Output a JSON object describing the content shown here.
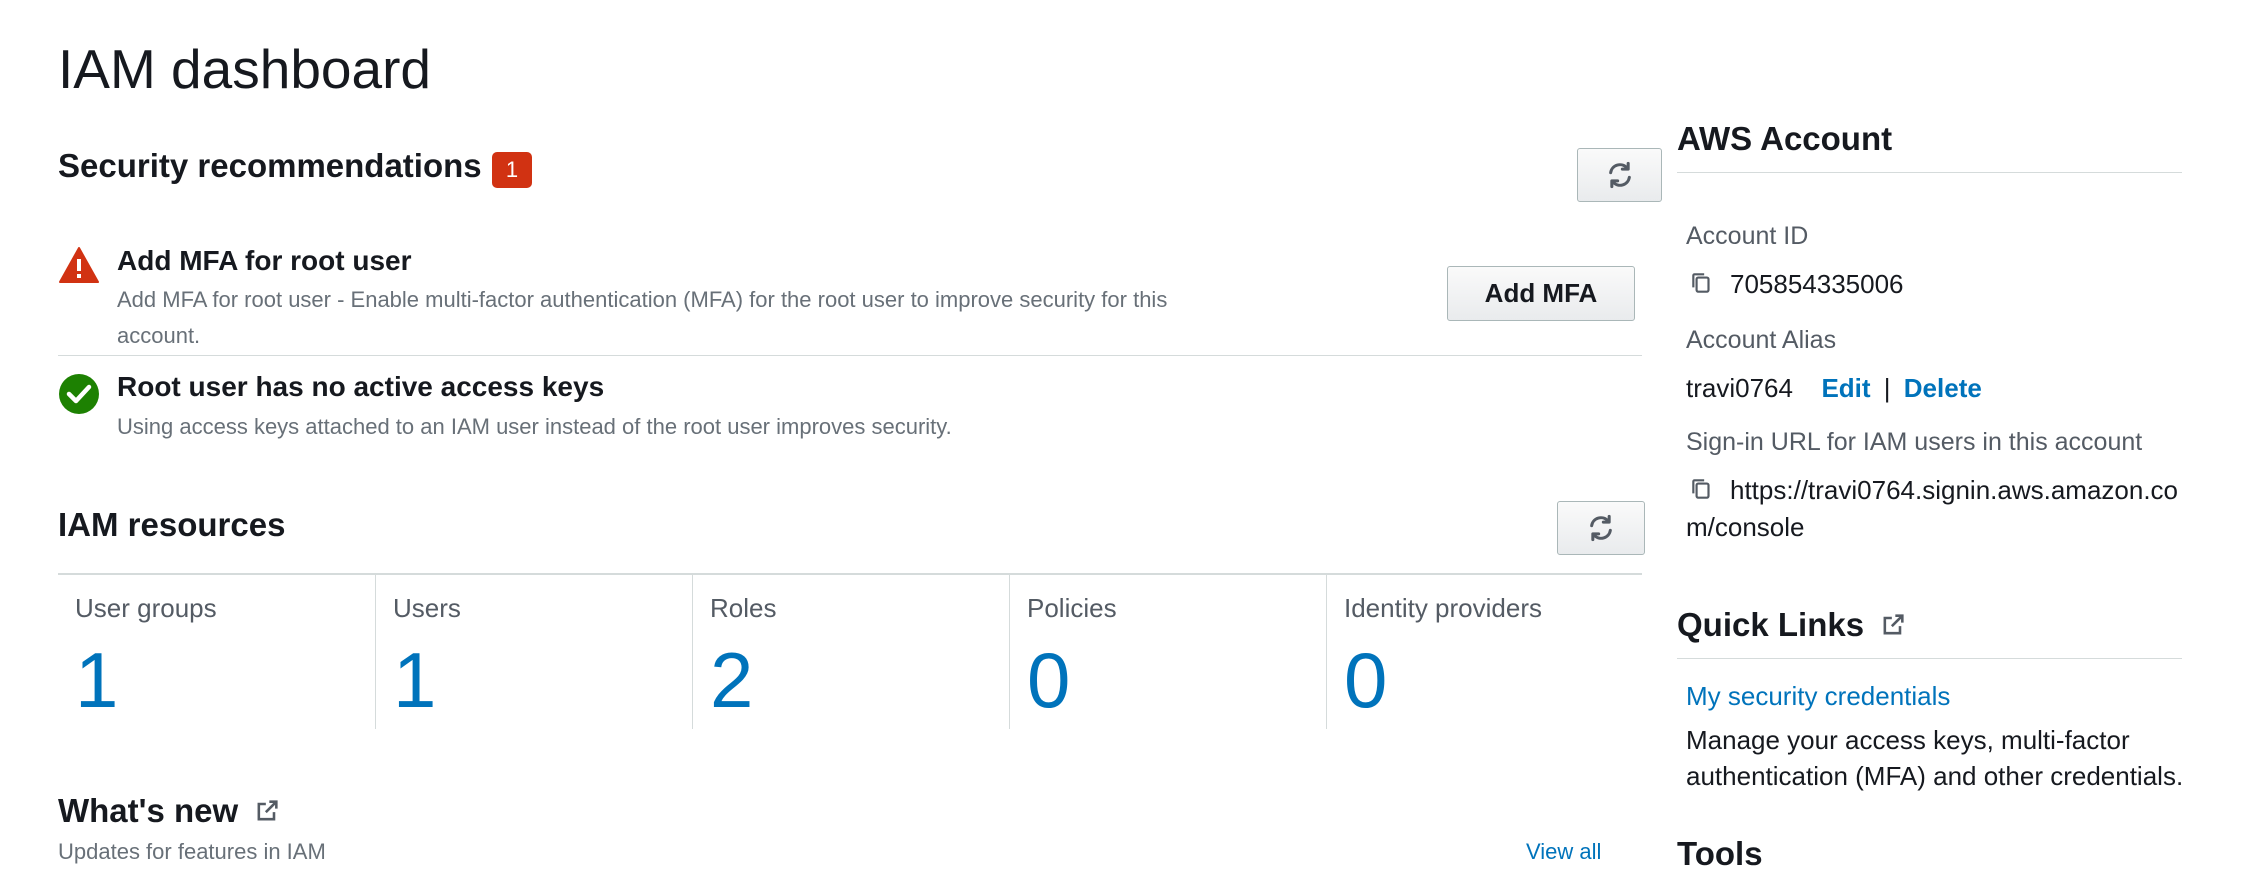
{
  "page": {
    "title": "IAM dashboard"
  },
  "security": {
    "heading": "Security recommendations",
    "badge_count": "1",
    "items": [
      {
        "title": "Add MFA for root user",
        "description_line1": "Add MFA for root user - Enable multi-factor authentication (MFA) for the root user to improve security for this",
        "description_line2": "account.",
        "status": "warning",
        "action_label": "Add MFA"
      },
      {
        "title": "Root user has no active access keys",
        "description_line1": "Using access keys attached to an IAM user instead of the root user improves security.",
        "status": "ok"
      }
    ]
  },
  "resources": {
    "heading": "IAM resources",
    "items": [
      {
        "label": "User groups",
        "count": "1"
      },
      {
        "label": "Users",
        "count": "1"
      },
      {
        "label": "Roles",
        "count": "2"
      },
      {
        "label": "Policies",
        "count": "0"
      },
      {
        "label": "Identity providers",
        "count": "0"
      }
    ]
  },
  "whats_new": {
    "heading": "What's new",
    "subtitle": "Updates for features in IAM",
    "view_all": "View all"
  },
  "account": {
    "heading": "AWS Account",
    "account_id_label": "Account ID",
    "account_id": "705854335006",
    "alias_label": "Account Alias",
    "alias": "travi0764",
    "edit_label": "Edit",
    "separator": "|",
    "delete_label": "Delete",
    "signin_label": "Sign-in URL for IAM users in this account",
    "signin_url_line1": "https://travi0764.signin.aws.amazon.co",
    "signin_url_line2": "m/console"
  },
  "quick_links": {
    "heading": "Quick Links",
    "link_label": "My security credentials",
    "desc_line1": "Manage your access keys, multi-factor",
    "desc_line2": "authentication (MFA) and other credentials."
  },
  "tools": {
    "heading": "Tools"
  },
  "colors": {
    "link": "#0073bb",
    "danger": "#d13212",
    "success": "#1d8102",
    "text": "#16191f"
  },
  "icons": [
    "refresh-icon",
    "warning-icon",
    "check-circle-icon",
    "copy-icon",
    "external-link-icon"
  ]
}
